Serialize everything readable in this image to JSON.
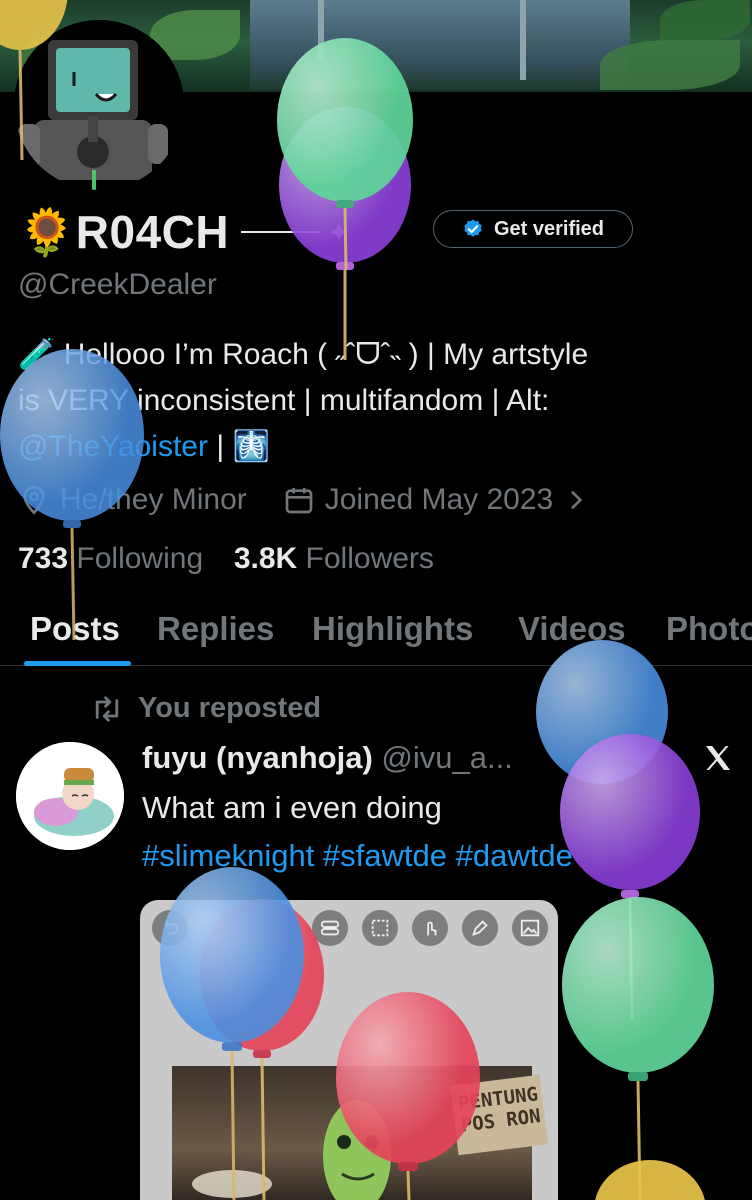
{
  "profile": {
    "name": "🌻R04CH",
    "name_suffix": "✦",
    "handle": "@CreekDealer",
    "get_verified_label": "Get verified",
    "bio_line1": "🧪 Hellooo I’m Roach ( ˶ˆᗜˆ˵ ) | My artstyle",
    "bio_line2": "is VERY inconsistent | multifandom | Alt:",
    "bio_link": "@TheYaoister",
    "bio_tail": " | 🩻",
    "location": "He/they Minor",
    "joined": "Joined May 2023",
    "following_count": "733",
    "following_label": "Following",
    "followers_count": "3.8K",
    "followers_label": "Followers"
  },
  "tabs": [
    "Posts",
    "Replies",
    "Highlights",
    "Videos",
    "Photos"
  ],
  "post": {
    "repost_label": "You reposted",
    "author": "fuyu (nyanhoja)",
    "author_handle": "@ivu_a...",
    "text": "What am i even doing",
    "hashtags": "#slimeknight #sfawtde #dawtde",
    "media_sign_text_1": "PENTUNG",
    "media_sign_text_2": "POS RON"
  },
  "icons": {
    "location": "location-pin-icon",
    "calendar": "calendar-icon",
    "chevron": "chevron-right-icon",
    "repost": "repost-icon",
    "verified": "verified-badge-icon",
    "x": "x-logo-icon"
  },
  "colors": {
    "accent": "#1d9bf0",
    "muted": "#71767b",
    "text": "#e7e9ea",
    "background": "#000000",
    "balloon_green": "#5fd69a",
    "balloon_purple": "#8b3fd9",
    "balloon_blue": "#4a90e2",
    "balloon_red": "#e5445a",
    "balloon_yellow": "#e8c44a"
  }
}
